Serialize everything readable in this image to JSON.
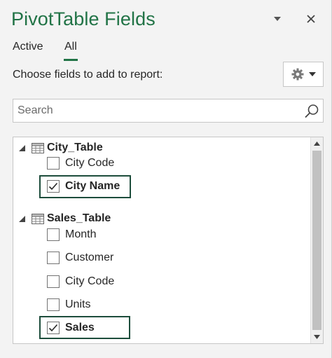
{
  "header": {
    "title": "PivotTable Fields",
    "dropdown_icon": "caret-down-icon",
    "close_icon": "close-icon"
  },
  "tabs": [
    {
      "label": "Active",
      "active": false
    },
    {
      "label": "All",
      "active": true
    }
  ],
  "toolbar": {
    "choose_label": "Choose fields to add to report:",
    "tools_icon": "gear-icon"
  },
  "search": {
    "placeholder": "Search",
    "value": ""
  },
  "tables": [
    {
      "name": "City_Table",
      "expanded": true,
      "fields": [
        {
          "label": "City Code",
          "checked": false
        },
        {
          "label": "City Name",
          "checked": true
        }
      ]
    },
    {
      "name": "Sales_Table",
      "expanded": true,
      "fields": [
        {
          "label": "Month",
          "checked": false
        },
        {
          "label": "Customer",
          "checked": false
        },
        {
          "label": "City Code",
          "checked": false
        },
        {
          "label": "Units",
          "checked": false
        },
        {
          "label": "Sales",
          "checked": true
        }
      ]
    }
  ],
  "colors": {
    "accent": "#217346",
    "highlight_border": "#1d4d3c",
    "pane_bg": "#f3f3f3"
  }
}
